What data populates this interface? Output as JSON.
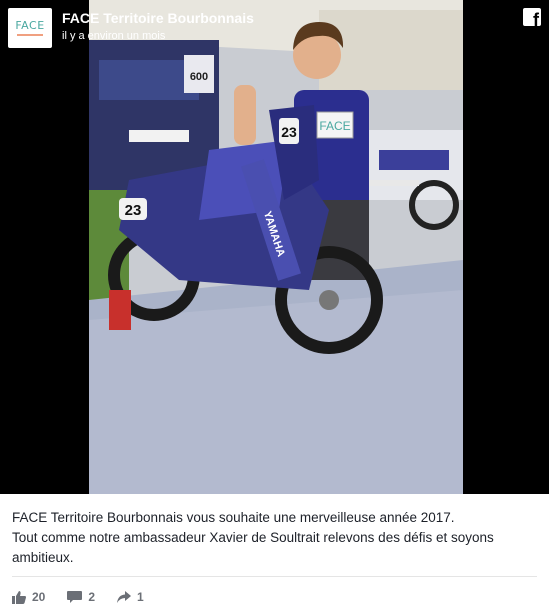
{
  "post": {
    "page_name": "FACE Territoire Bourbonnais",
    "timestamp": "il y a environ un mois",
    "logo_text": "FACE",
    "message_lines": [
      "FACE Territoire Bourbonnais vous souhaite une merveilleuse année 2017.",
      "Tout comme notre ambassadeur Xavier de Soultrait relevons des défis et soyons ambitieux."
    ]
  },
  "photo": {
    "bib_number": "23",
    "sign_text": "FACE",
    "bike_brand": "YAMAHA",
    "truck_number": "600"
  },
  "stats": {
    "likes": "20",
    "comments": "2",
    "shares": "1"
  },
  "icons": {
    "brand": "facebook-icon",
    "like": "thumbs-up-icon",
    "comment": "comment-icon",
    "share": "share-icon"
  },
  "colors": {
    "brand_teal": "#4aa8a0",
    "media_bg": "#000000",
    "footer_text": "#6b6f76"
  }
}
